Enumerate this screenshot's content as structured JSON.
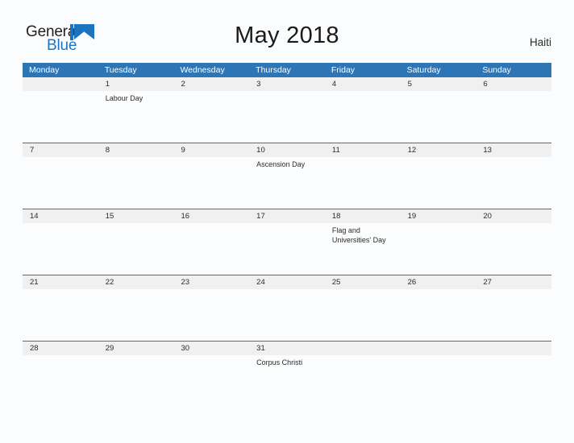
{
  "brand": {
    "name_part1": "General",
    "name_part2": "Blue",
    "mark_icon": "triangle-flag-icon",
    "color_dark": "#231f20",
    "color_blue": "#1d74bd"
  },
  "header": {
    "title": "May 2018",
    "country": "Haiti"
  },
  "theme": {
    "header_blue": "#2e75b6",
    "daynum_band": "#f0f0f0",
    "page_background": "#fbfcfd",
    "text": "#2b2b2b"
  },
  "calendar": {
    "weekdays": [
      "Monday",
      "Tuesday",
      "Wednesday",
      "Thursday",
      "Friday",
      "Saturday",
      "Sunday"
    ],
    "weeks": [
      {
        "days": [
          {
            "number": "",
            "event": ""
          },
          {
            "number": "1",
            "event": "Labour Day"
          },
          {
            "number": "2",
            "event": ""
          },
          {
            "number": "3",
            "event": ""
          },
          {
            "number": "4",
            "event": ""
          },
          {
            "number": "5",
            "event": ""
          },
          {
            "number": "6",
            "event": ""
          }
        ]
      },
      {
        "days": [
          {
            "number": "7",
            "event": ""
          },
          {
            "number": "8",
            "event": ""
          },
          {
            "number": "9",
            "event": ""
          },
          {
            "number": "10",
            "event": "Ascension Day"
          },
          {
            "number": "11",
            "event": ""
          },
          {
            "number": "12",
            "event": ""
          },
          {
            "number": "13",
            "event": ""
          }
        ]
      },
      {
        "days": [
          {
            "number": "14",
            "event": ""
          },
          {
            "number": "15",
            "event": ""
          },
          {
            "number": "16",
            "event": ""
          },
          {
            "number": "17",
            "event": ""
          },
          {
            "number": "18",
            "event": "Flag and Universities' Day"
          },
          {
            "number": "19",
            "event": ""
          },
          {
            "number": "20",
            "event": ""
          }
        ]
      },
      {
        "days": [
          {
            "number": "21",
            "event": ""
          },
          {
            "number": "22",
            "event": ""
          },
          {
            "number": "23",
            "event": ""
          },
          {
            "number": "24",
            "event": ""
          },
          {
            "number": "25",
            "event": ""
          },
          {
            "number": "26",
            "event": ""
          },
          {
            "number": "27",
            "event": ""
          }
        ]
      },
      {
        "days": [
          {
            "number": "28",
            "event": ""
          },
          {
            "number": "29",
            "event": ""
          },
          {
            "number": "30",
            "event": ""
          },
          {
            "number": "31",
            "event": "Corpus Christi"
          },
          {
            "number": "",
            "event": ""
          },
          {
            "number": "",
            "event": ""
          },
          {
            "number": "",
            "event": ""
          }
        ]
      }
    ]
  }
}
